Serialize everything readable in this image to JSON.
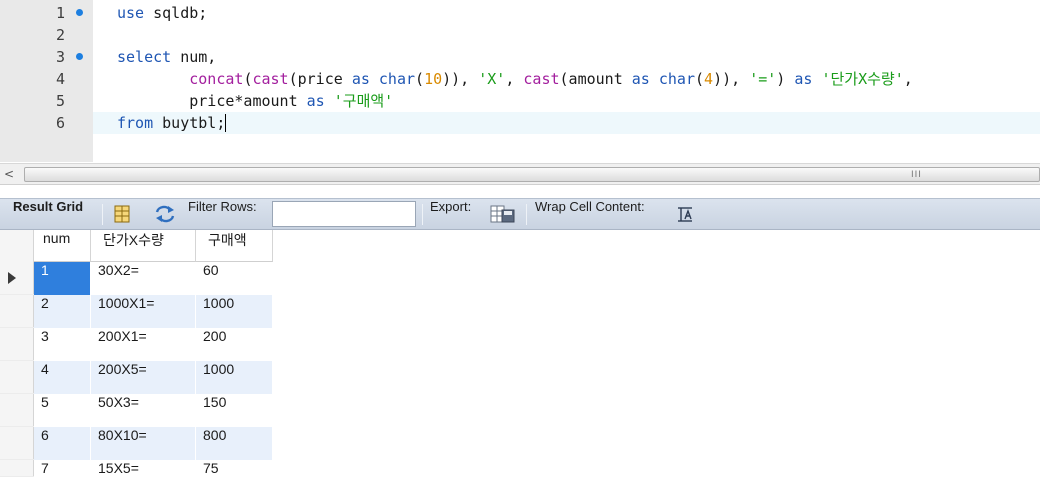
{
  "editor": {
    "lines": [
      {
        "no": "1",
        "breakpoint": true
      },
      {
        "no": "2",
        "breakpoint": false
      },
      {
        "no": "3",
        "breakpoint": true
      },
      {
        "no": "4",
        "breakpoint": false
      },
      {
        "no": "5",
        "breakpoint": false
      },
      {
        "no": "6",
        "breakpoint": false
      }
    ],
    "code": {
      "l1_kw": "use",
      "l1_rest": " sqldb;",
      "l3_kw": "select",
      "l3_rest": " num,",
      "l4_indent": "        ",
      "l4_concat": "concat",
      "l4_p1": "(",
      "l4_cast1": "cast",
      "l4_p2": "(price ",
      "l4_as1": "as",
      "l4_sp1": " ",
      "l4_char1": "char",
      "l4_p3": "(",
      "l4_n10": "10",
      "l4_p4": ")), ",
      "l4_sX": "'X'",
      "l4_p5": ", ",
      "l4_cast2": "cast",
      "l4_p6": "(amount ",
      "l4_as2": "as",
      "l4_sp2": " ",
      "l4_char2": "char",
      "l4_p7": "(",
      "l4_n4": "4",
      "l4_p8": ")), ",
      "l4_seq": "'='",
      "l4_p9": ") ",
      "l4_as3": "as",
      "l4_sp3": " ",
      "l4_salias": "'단가X수량'",
      "l4_p10": ",",
      "l5_indent": "        ",
      "l5_expr": "price*amount ",
      "l5_as": "as",
      "l5_sp": " ",
      "l5_salias": "'구매액'",
      "l6_kw": "from",
      "l6_rest": " buytbl;"
    }
  },
  "scrollbar": {
    "left_arrow": "<",
    "grip": "III"
  },
  "toolbar": {
    "result_grid": "Result Grid",
    "filter_rows": "Filter Rows:",
    "filter_value": "",
    "export": "Export:",
    "wrap_cell_content": "Wrap Cell Content:"
  },
  "grid": {
    "columns": [
      "num",
      "단가X수량",
      "구매액"
    ],
    "rows": [
      [
        "1",
        "30X2=",
        "60"
      ],
      [
        "2",
        "1000X1=",
        "1000"
      ],
      [
        "3",
        "200X1=",
        "200"
      ],
      [
        "4",
        "200X5=",
        "1000"
      ],
      [
        "5",
        "50X3=",
        "150"
      ],
      [
        "6",
        "80X10=",
        "800"
      ],
      [
        "7",
        "15X5=",
        "75"
      ]
    ],
    "selected_row": 0
  },
  "colors": {
    "keyword": "#1f56b3",
    "function": "#a31f9e",
    "number": "#d98a00",
    "string": "#1a9c1a",
    "selection": "#2f7fdd",
    "alt_row": "#e8f0fb"
  }
}
